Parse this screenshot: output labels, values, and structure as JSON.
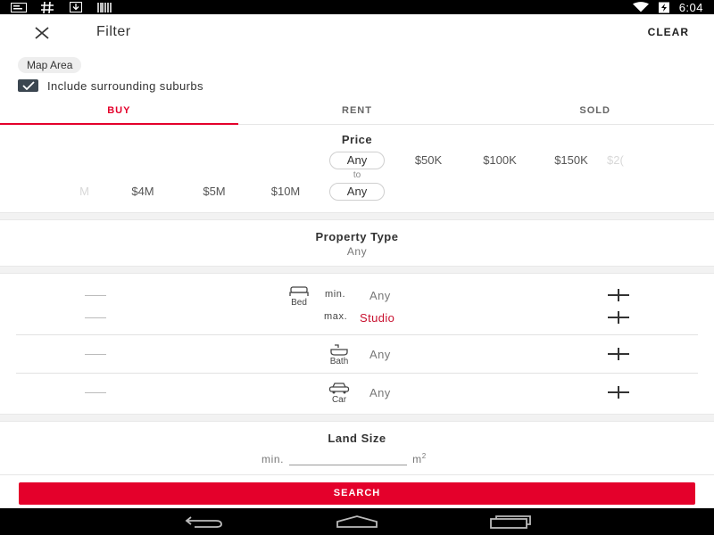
{
  "status_bar": {
    "time": "6:04",
    "left_icons": [
      "notification-message-icon",
      "hashtag-icon",
      "download-icon",
      "barcode-icon"
    ],
    "right_icons": [
      "wifi-icon",
      "battery-charging-icon"
    ]
  },
  "header": {
    "title": "Filter",
    "clear_label": "CLEAR",
    "close_icon": "close-icon"
  },
  "map_area": {
    "chip_label": "Map Area",
    "include_surrounding_label": "Include surrounding suburbs",
    "include_surrounding_checked": true
  },
  "tabs": [
    {
      "label": "BUY",
      "active": true
    },
    {
      "label": "RENT",
      "active": false
    },
    {
      "label": "SOLD",
      "active": false
    }
  ],
  "price": {
    "title": "Price",
    "to_label": "to",
    "min_options": [
      "Any",
      "$50K",
      "$100K",
      "$150K",
      "$2("
    ],
    "min_selected": "Any",
    "max_options": [
      "M",
      "$4M",
      "$5M",
      "$10M",
      "Any"
    ],
    "max_selected": "Any"
  },
  "property_type": {
    "title": "Property Type",
    "value": "Any"
  },
  "counters": {
    "bed": {
      "label": "Bed",
      "min_label": "min.",
      "min_value": "Any",
      "max_label": "max.",
      "max_value": "Studio"
    },
    "bath": {
      "label": "Bath",
      "value": "Any"
    },
    "car": {
      "label": "Car",
      "value": "Any"
    }
  },
  "land_size": {
    "title": "Land Size",
    "min_label": "min.",
    "unit": "m",
    "unit_sup": "2"
  },
  "search_label": "SEARCH",
  "colors": {
    "accent": "#e4002b",
    "studio_text": "#c8102e",
    "checkbox": "#3b4650"
  },
  "nav_bar": {
    "buttons": [
      "back-icon",
      "home-icon",
      "recents-icon"
    ]
  }
}
